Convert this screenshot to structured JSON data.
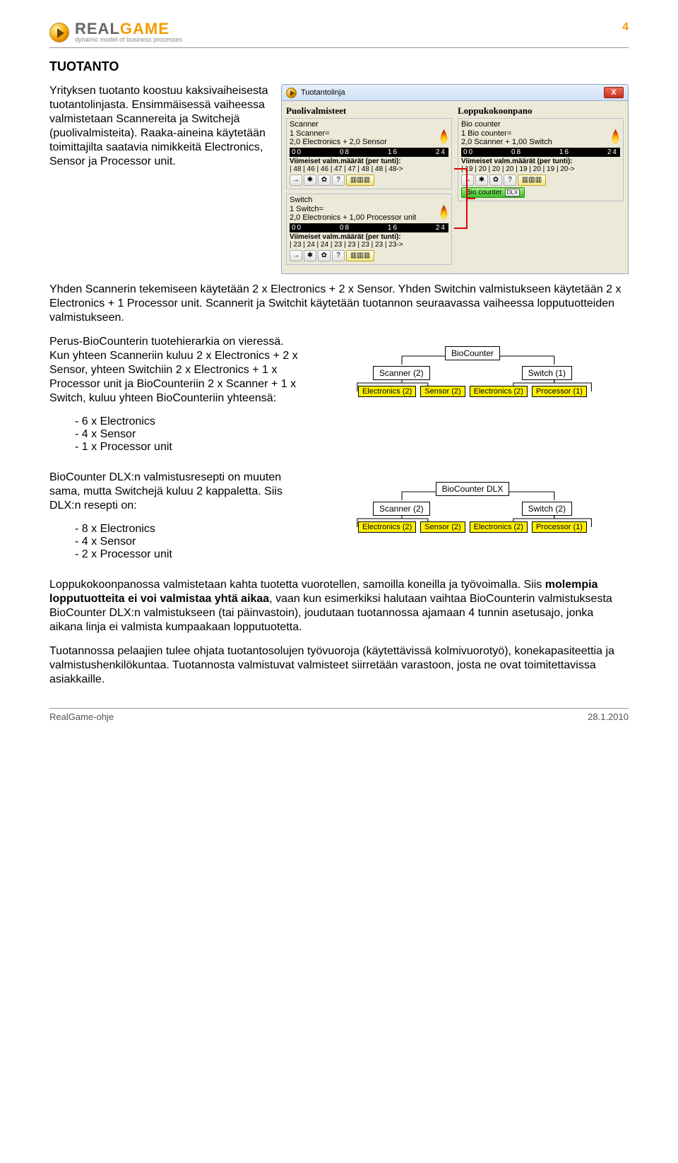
{
  "page_number": "4",
  "brand": {
    "real": "REAL",
    "game": "GAME",
    "sub": "dynamic model of business processes"
  },
  "h1": "TUOTANTO",
  "intro_left": "Yrityksen tuotanto koostuu kaksivaiheisesta tuotantolinjasta. Ensimmäisessä vaiheessa valmistetaan Scannereita ja Switchejä (puolivalmisteita). Raaka-aineina käytetään toimittajilta saatavia nimikkeitä Electronics, Sensor ja Processor unit.",
  "window": {
    "title": "Tuotantolinja",
    "close": "X",
    "left_col_title": "Puolivalmisteet",
    "right_col_title": "Loppukokoonpano",
    "scanner": {
      "box_title": "Scanner",
      "line1": "1 Scanner=",
      "line2": "2,0 Electronics + 2,0 Sensor",
      "times": [
        "00",
        "08",
        "16",
        "24"
      ],
      "tt": "Viimeiset valm.määrät (per tunti):",
      "counts": "| 48 | 46 | 46 | 47 | 47 | 48 | 48 | 48->"
    },
    "switch": {
      "box_title": "Switch",
      "line1": "1 Switch=",
      "line2": "2,0 Electronics + 1,00 Processor unit",
      "times": [
        "00",
        "08",
        "16",
        "24"
      ],
      "tt": "Viimeiset valm.määrät (per tunti):",
      "counts": "| 23 | 24 | 24 | 23 | 23 | 23 | 23 | 23->"
    },
    "bio": {
      "box_title": "Bio counter",
      "line1": "1 Bio counter=",
      "line2": "2,0 Scanner + 1,00 Switch",
      "times": [
        "00",
        "08",
        "16",
        "24"
      ],
      "tt": "Viimeiset valm.määrät (per tunti):",
      "counts": "| 19 | 20 | 20 | 20 | 19 | 20 | 19 | 20->"
    },
    "btn_set": {
      "arrow": "→",
      "plus": "✱",
      "person": "✿",
      "q": "?",
      "meter": "▥▥▥"
    },
    "green_label": "Bio counter",
    "green_sub": "DLX"
  },
  "para2": "Yhden Scannerin tekemiseen käytetään 2 x Electronics + 2 x Sensor. Yhden Switchin valmistukseen käytetään 2 x Electronics + 1 Processor unit. Scannerit ja Switchit käytetään tuotannon seuraavassa vaiheessa lopputuotteiden valmistukseen.",
  "block3": {
    "text": "Perus-BioCounterin tuotehierarkia on vieressä. Kun yhteen Scanneriin kuluu 2 x Electronics + 2 x Sensor, yhteen Switchiin 2 x Electronics + 1 x Processor unit ja BioCounteriin 2 x Scanner + 1 x Switch, kuluu yhteen BioCounteriin yhteensä:",
    "items": [
      "6 x Electronics",
      "4 x Sensor",
      "1 x Processor unit"
    ]
  },
  "hier_basic": {
    "root": "BioCounter",
    "mids": [
      "Scanner (2)",
      "Switch (1)"
    ],
    "leafs": [
      "Electronics (2)",
      "Sensor (2)",
      "Electronics (2)",
      "Processor (1)"
    ]
  },
  "block4": {
    "text": "BioCounter DLX:n valmistusresepti on muuten sama, mutta Switchejä kuluu 2 kappaletta. Siis DLX:n resepti on:",
    "items": [
      "8 x Electronics",
      "4 x Sensor",
      "2 x Processor unit"
    ]
  },
  "hier_dlx": {
    "root": "BioCounter DLX",
    "mids": [
      "Scanner (2)",
      "Switch (2)"
    ],
    "leafs": [
      "Electronics (2)",
      "Sensor (2)",
      "Electronics (2)",
      "Processor (1)"
    ]
  },
  "para5a": "Loppukokoonpanossa valmistetaan kahta tuotetta vuorotellen, samoilla koneilla ja työvoimalla. Siis ",
  "para5b": "molempia lopputuotteita ei voi valmistaa yhtä aikaa",
  "para5c": ", vaan kun esimerkiksi halutaan vaihtaa BioCounterin valmistuksesta BioCounter DLX:n valmistukseen (tai päinvastoin), joudutaan tuotannossa ajamaan 4 tunnin asetusajo, jonka aikana linja ei valmista kumpaakaan lopputuotetta.",
  "para6": "Tuotannossa pelaajien tulee ohjata tuotantosolujen työvuoroja (käytettävissä kolmivuorotyö), konekapasiteettia ja valmistushenkilökuntaa. Tuotannosta valmistuvat valmisteet siirretään varastoon, josta ne ovat toimitettavissa asiakkaille.",
  "footer": {
    "left": "RealGame-ohje",
    "right": "28.1.2010"
  }
}
